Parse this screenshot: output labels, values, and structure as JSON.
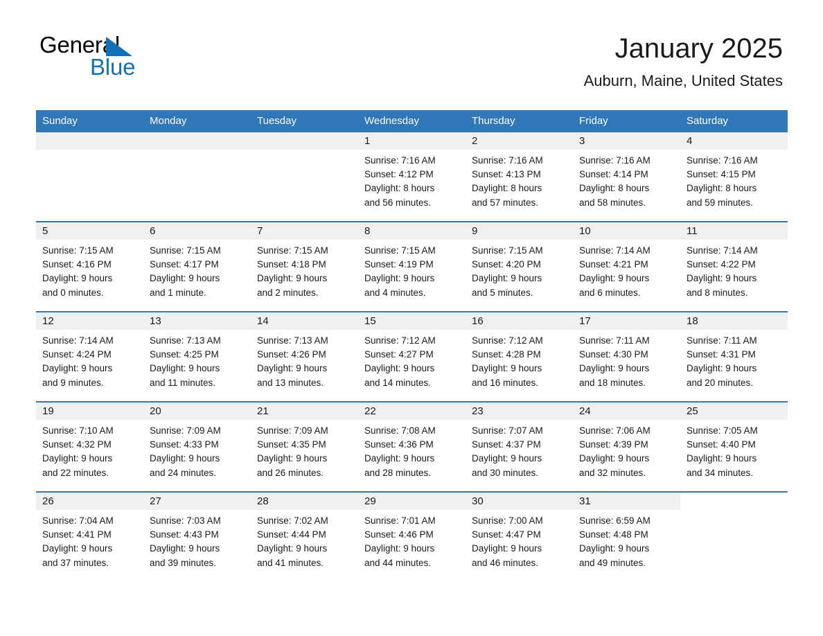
{
  "brand": {
    "name_part1": "General",
    "name_part2": "Blue",
    "triangle_color": "#1270b8"
  },
  "header": {
    "title": "January 2025",
    "subtitle": "Auburn, Maine, United States"
  },
  "theme": {
    "header_blue": "#3077b7",
    "daynum_band": "#f0f0f0",
    "text": "#1a1a1a"
  },
  "weekday_headers": [
    "Sunday",
    "Monday",
    "Tuesday",
    "Wednesday",
    "Thursday",
    "Friday",
    "Saturday"
  ],
  "weeks": [
    [
      {
        "day": "",
        "sunrise": "",
        "sunset": "",
        "daylight1": "",
        "daylight2": "",
        "empty": true
      },
      {
        "day": "",
        "sunrise": "",
        "sunset": "",
        "daylight1": "",
        "daylight2": "",
        "empty": true
      },
      {
        "day": "",
        "sunrise": "",
        "sunset": "",
        "daylight1": "",
        "daylight2": "",
        "empty": true
      },
      {
        "day": "1",
        "sunrise": "Sunrise: 7:16 AM",
        "sunset": "Sunset: 4:12 PM",
        "daylight1": "Daylight: 8 hours",
        "daylight2": "and 56 minutes."
      },
      {
        "day": "2",
        "sunrise": "Sunrise: 7:16 AM",
        "sunset": "Sunset: 4:13 PM",
        "daylight1": "Daylight: 8 hours",
        "daylight2": "and 57 minutes."
      },
      {
        "day": "3",
        "sunrise": "Sunrise: 7:16 AM",
        "sunset": "Sunset: 4:14 PM",
        "daylight1": "Daylight: 8 hours",
        "daylight2": "and 58 minutes."
      },
      {
        "day": "4",
        "sunrise": "Sunrise: 7:16 AM",
        "sunset": "Sunset: 4:15 PM",
        "daylight1": "Daylight: 8 hours",
        "daylight2": "and 59 minutes."
      }
    ],
    [
      {
        "day": "5",
        "sunrise": "Sunrise: 7:15 AM",
        "sunset": "Sunset: 4:16 PM",
        "daylight1": "Daylight: 9 hours",
        "daylight2": "and 0 minutes."
      },
      {
        "day": "6",
        "sunrise": "Sunrise: 7:15 AM",
        "sunset": "Sunset: 4:17 PM",
        "daylight1": "Daylight: 9 hours",
        "daylight2": "and 1 minute."
      },
      {
        "day": "7",
        "sunrise": "Sunrise: 7:15 AM",
        "sunset": "Sunset: 4:18 PM",
        "daylight1": "Daylight: 9 hours",
        "daylight2": "and 2 minutes."
      },
      {
        "day": "8",
        "sunrise": "Sunrise: 7:15 AM",
        "sunset": "Sunset: 4:19 PM",
        "daylight1": "Daylight: 9 hours",
        "daylight2": "and 4 minutes."
      },
      {
        "day": "9",
        "sunrise": "Sunrise: 7:15 AM",
        "sunset": "Sunset: 4:20 PM",
        "daylight1": "Daylight: 9 hours",
        "daylight2": "and 5 minutes."
      },
      {
        "day": "10",
        "sunrise": "Sunrise: 7:14 AM",
        "sunset": "Sunset: 4:21 PM",
        "daylight1": "Daylight: 9 hours",
        "daylight2": "and 6 minutes."
      },
      {
        "day": "11",
        "sunrise": "Sunrise: 7:14 AM",
        "sunset": "Sunset: 4:22 PM",
        "daylight1": "Daylight: 9 hours",
        "daylight2": "and 8 minutes."
      }
    ],
    [
      {
        "day": "12",
        "sunrise": "Sunrise: 7:14 AM",
        "sunset": "Sunset: 4:24 PM",
        "daylight1": "Daylight: 9 hours",
        "daylight2": "and 9 minutes."
      },
      {
        "day": "13",
        "sunrise": "Sunrise: 7:13 AM",
        "sunset": "Sunset: 4:25 PM",
        "daylight1": "Daylight: 9 hours",
        "daylight2": "and 11 minutes."
      },
      {
        "day": "14",
        "sunrise": "Sunrise: 7:13 AM",
        "sunset": "Sunset: 4:26 PM",
        "daylight1": "Daylight: 9 hours",
        "daylight2": "and 13 minutes."
      },
      {
        "day": "15",
        "sunrise": "Sunrise: 7:12 AM",
        "sunset": "Sunset: 4:27 PM",
        "daylight1": "Daylight: 9 hours",
        "daylight2": "and 14 minutes."
      },
      {
        "day": "16",
        "sunrise": "Sunrise: 7:12 AM",
        "sunset": "Sunset: 4:28 PM",
        "daylight1": "Daylight: 9 hours",
        "daylight2": "and 16 minutes."
      },
      {
        "day": "17",
        "sunrise": "Sunrise: 7:11 AM",
        "sunset": "Sunset: 4:30 PM",
        "daylight1": "Daylight: 9 hours",
        "daylight2": "and 18 minutes."
      },
      {
        "day": "18",
        "sunrise": "Sunrise: 7:11 AM",
        "sunset": "Sunset: 4:31 PM",
        "daylight1": "Daylight: 9 hours",
        "daylight2": "and 20 minutes."
      }
    ],
    [
      {
        "day": "19",
        "sunrise": "Sunrise: 7:10 AM",
        "sunset": "Sunset: 4:32 PM",
        "daylight1": "Daylight: 9 hours",
        "daylight2": "and 22 minutes."
      },
      {
        "day": "20",
        "sunrise": "Sunrise: 7:09 AM",
        "sunset": "Sunset: 4:33 PM",
        "daylight1": "Daylight: 9 hours",
        "daylight2": "and 24 minutes."
      },
      {
        "day": "21",
        "sunrise": "Sunrise: 7:09 AM",
        "sunset": "Sunset: 4:35 PM",
        "daylight1": "Daylight: 9 hours",
        "daylight2": "and 26 minutes."
      },
      {
        "day": "22",
        "sunrise": "Sunrise: 7:08 AM",
        "sunset": "Sunset: 4:36 PM",
        "daylight1": "Daylight: 9 hours",
        "daylight2": "and 28 minutes."
      },
      {
        "day": "23",
        "sunrise": "Sunrise: 7:07 AM",
        "sunset": "Sunset: 4:37 PM",
        "daylight1": "Daylight: 9 hours",
        "daylight2": "and 30 minutes."
      },
      {
        "day": "24",
        "sunrise": "Sunrise: 7:06 AM",
        "sunset": "Sunset: 4:39 PM",
        "daylight1": "Daylight: 9 hours",
        "daylight2": "and 32 minutes."
      },
      {
        "day": "25",
        "sunrise": "Sunrise: 7:05 AM",
        "sunset": "Sunset: 4:40 PM",
        "daylight1": "Daylight: 9 hours",
        "daylight2": "and 34 minutes."
      }
    ],
    [
      {
        "day": "26",
        "sunrise": "Sunrise: 7:04 AM",
        "sunset": "Sunset: 4:41 PM",
        "daylight1": "Daylight: 9 hours",
        "daylight2": "and 37 minutes."
      },
      {
        "day": "27",
        "sunrise": "Sunrise: 7:03 AM",
        "sunset": "Sunset: 4:43 PM",
        "daylight1": "Daylight: 9 hours",
        "daylight2": "and 39 minutes."
      },
      {
        "day": "28",
        "sunrise": "Sunrise: 7:02 AM",
        "sunset": "Sunset: 4:44 PM",
        "daylight1": "Daylight: 9 hours",
        "daylight2": "and 41 minutes."
      },
      {
        "day": "29",
        "sunrise": "Sunrise: 7:01 AM",
        "sunset": "Sunset: 4:46 PM",
        "daylight1": "Daylight: 9 hours",
        "daylight2": "and 44 minutes."
      },
      {
        "day": "30",
        "sunrise": "Sunrise: 7:00 AM",
        "sunset": "Sunset: 4:47 PM",
        "daylight1": "Daylight: 9 hours",
        "daylight2": "and 46 minutes."
      },
      {
        "day": "31",
        "sunrise": "Sunrise: 6:59 AM",
        "sunset": "Sunset: 4:48 PM",
        "daylight1": "Daylight: 9 hours",
        "daylight2": "and 49 minutes."
      },
      {
        "day": "",
        "sunrise": "",
        "sunset": "",
        "daylight1": "",
        "daylight2": "",
        "empty": true,
        "noband": true
      }
    ]
  ]
}
